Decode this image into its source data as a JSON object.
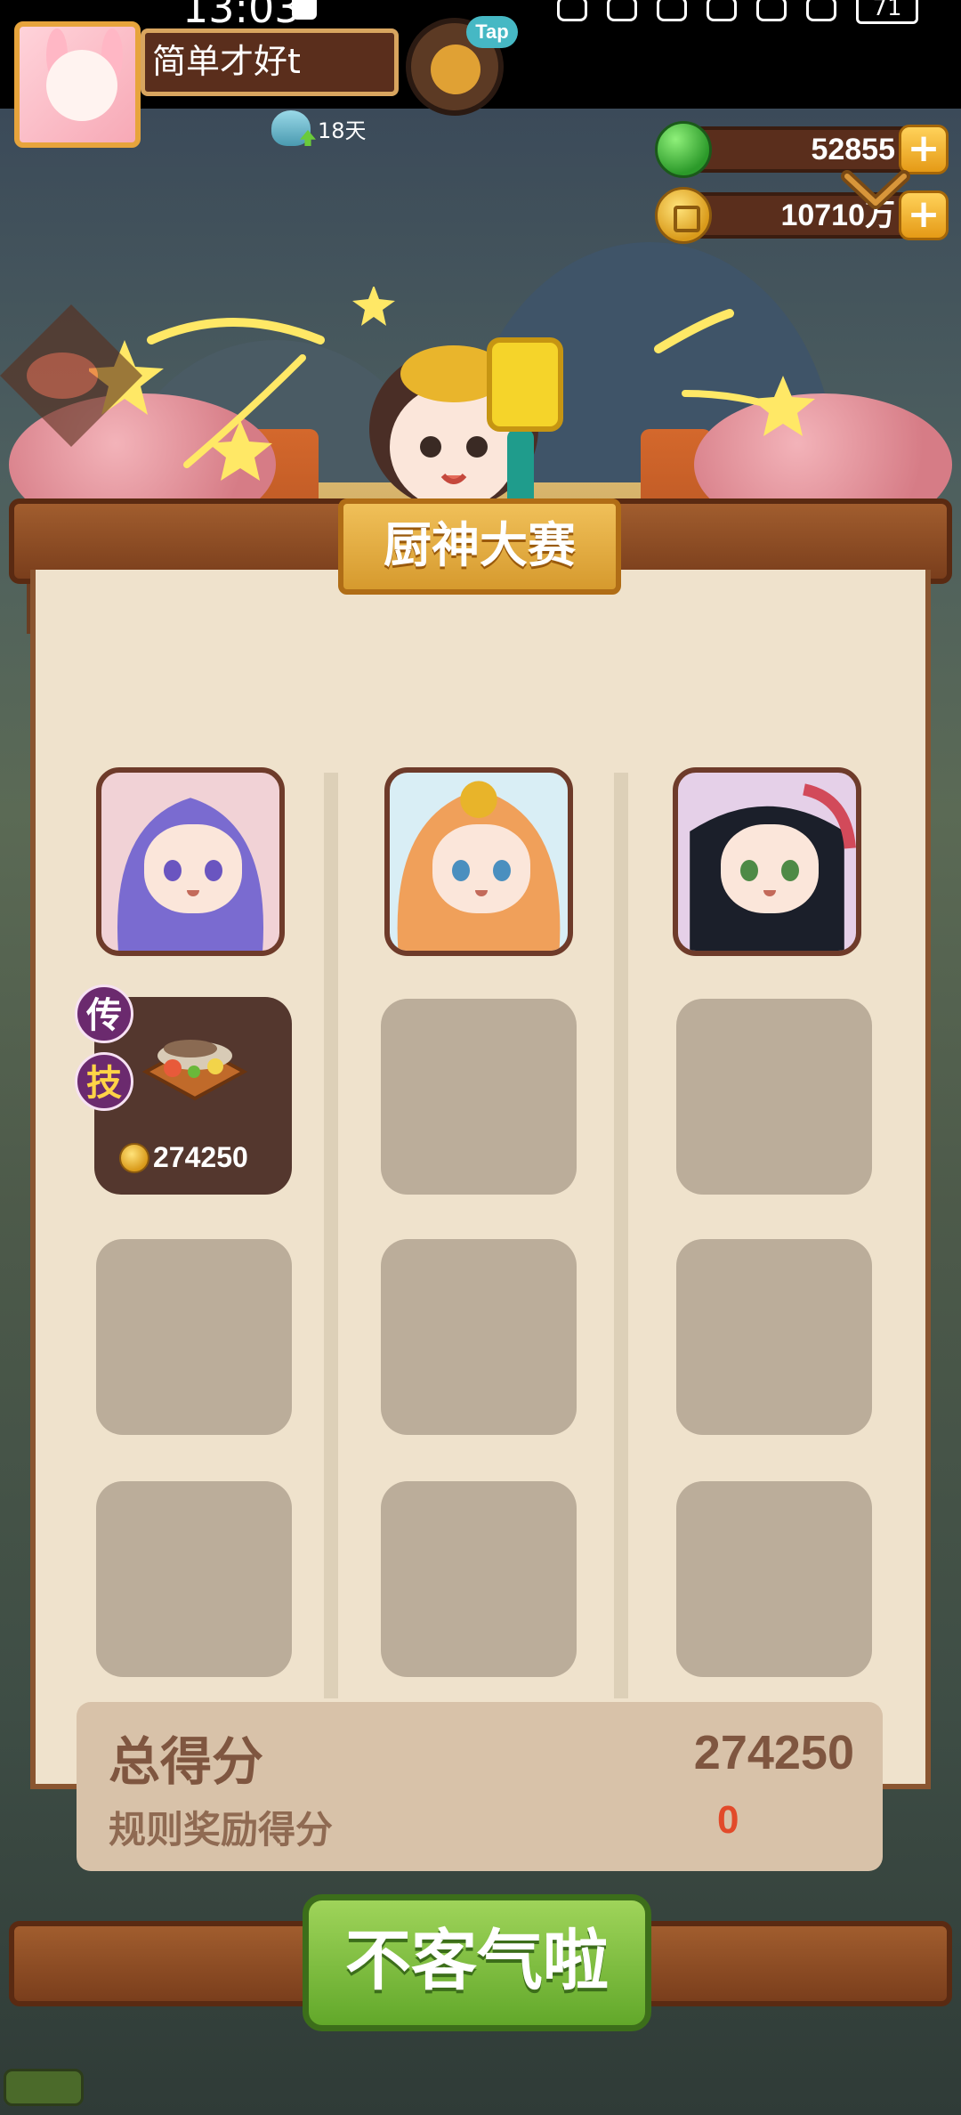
{
  "status_bar": {
    "time": "13:03",
    "battery": "71"
  },
  "player": {
    "name": "简单才好t",
    "days": "18天",
    "tap_badge": "Tap"
  },
  "currencies": {
    "apples": "52855",
    "coins": "10710万",
    "plus": "+"
  },
  "panel": {
    "title": "厨神大赛",
    "chefs": [
      {
        "name": "chef-1",
        "hair_color": "#7a6bd0",
        "bg": "#f1d2d6"
      },
      {
        "name": "chef-2",
        "hair_color": "#f0a05a",
        "bg": "#d9eef5"
      },
      {
        "name": "chef-3",
        "hair_color": "#1b1f2a",
        "bg": "#e5d0e8"
      }
    ],
    "dish": {
      "tag_legend": "传",
      "tag_skill": "技",
      "score": "274250"
    }
  },
  "score_box": {
    "total_label": "总得分",
    "total_value": "274250",
    "bonus_label": "规则奖励得分",
    "bonus_value": "0"
  },
  "confirm_button": "不客气啦",
  "colors": {
    "panel_bg": "#efe2cc",
    "title_gold": "#e4a93c",
    "confirm_green": "#7cbc3e",
    "bonus_red": "#e24a2a"
  }
}
